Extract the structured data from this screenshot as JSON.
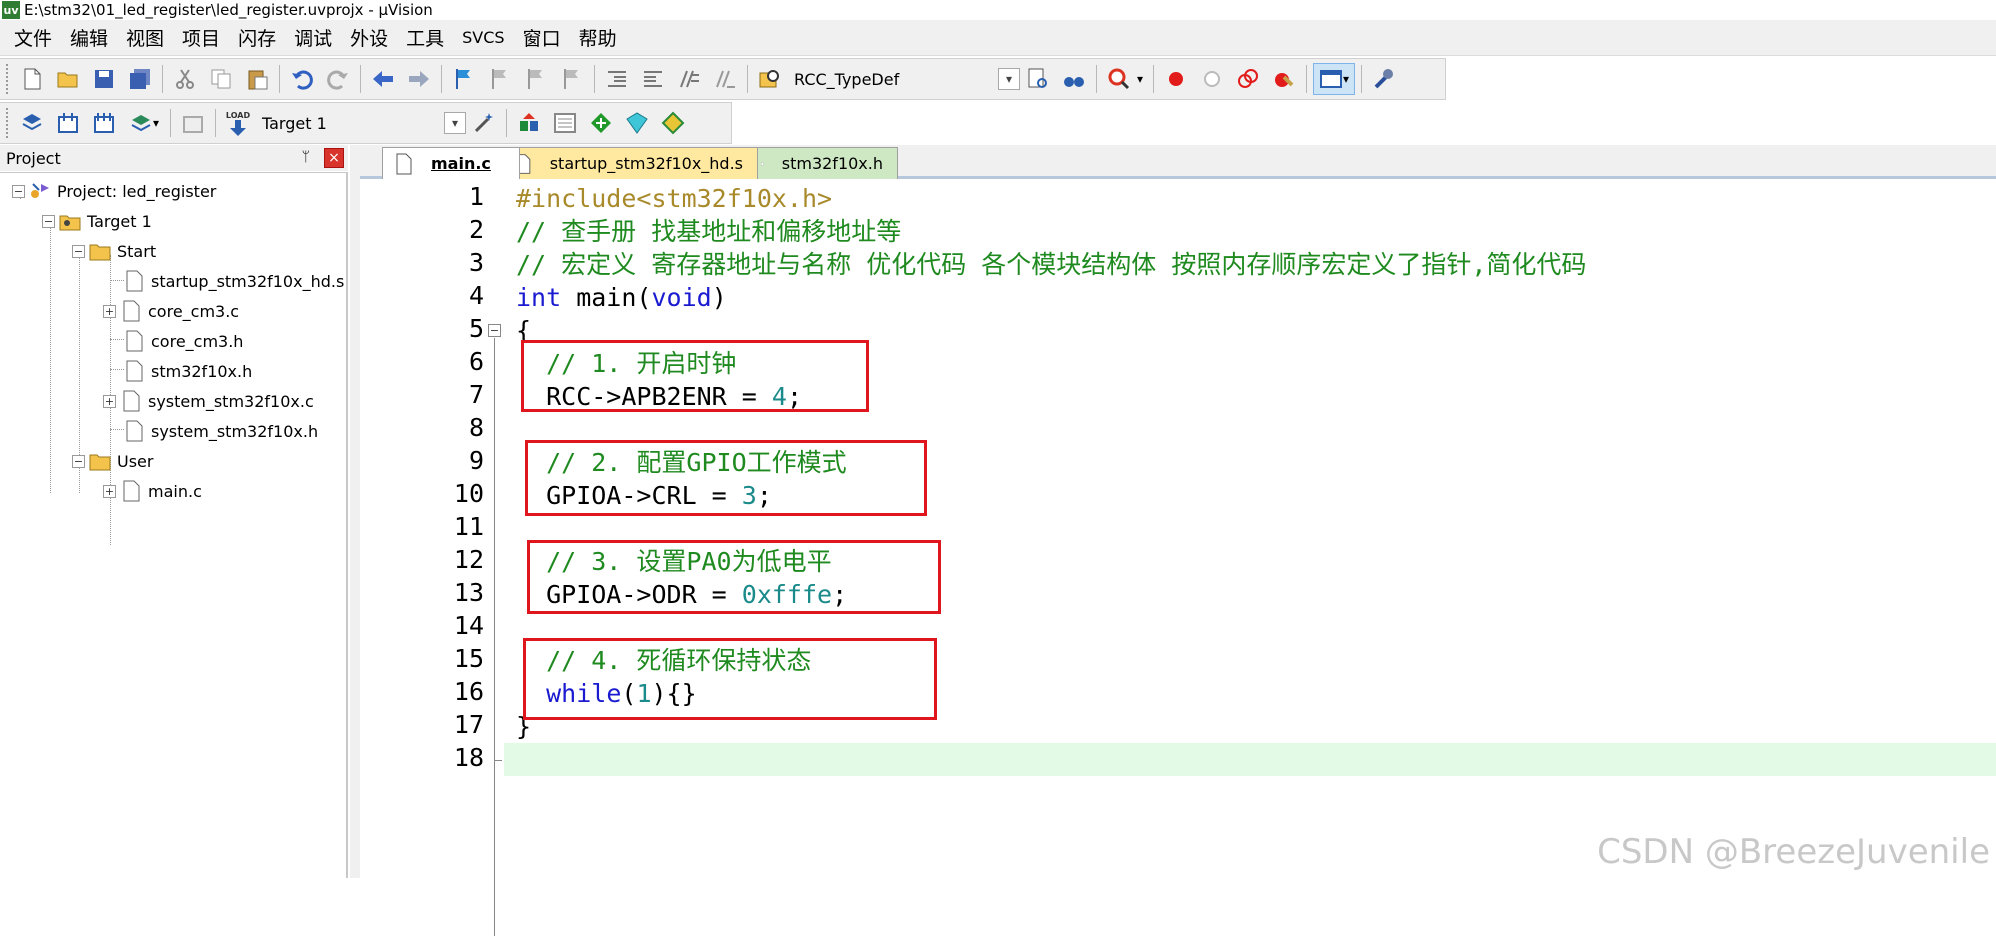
{
  "window": {
    "title": "E:\\stm32\\01_led_register\\led_register.uvprojx - µVision",
    "app_icon": "uv"
  },
  "menu": [
    "文件",
    "编辑",
    "视图",
    "项目",
    "闪存",
    "调试",
    "外设",
    "工具",
    "SVCS",
    "窗口",
    "帮助"
  ],
  "toolbar1": {
    "combo_value": "RCC_TypeDef"
  },
  "toolbar2": {
    "target_value": "Target 1",
    "load_label": "LOAD"
  },
  "project_panel": {
    "title": "Project",
    "pin_glyph": "ᛘ",
    "close_glyph": "×",
    "tree": [
      {
        "label": "Project: led_register",
        "expander": "−"
      },
      {
        "label": "Target 1",
        "expander": "−"
      },
      {
        "label": "Start",
        "expander": "−"
      },
      {
        "label": "startup_stm32f10x_hd.s",
        "expander": ""
      },
      {
        "label": "core_cm3.c",
        "expander": "+"
      },
      {
        "label": "core_cm3.h",
        "expander": ""
      },
      {
        "label": "stm32f10x.h",
        "expander": ""
      },
      {
        "label": "system_stm32f10x.c",
        "expander": "+"
      },
      {
        "label": "system_stm32f10x.h",
        "expander": ""
      },
      {
        "label": "User",
        "expander": "−"
      },
      {
        "label": "main.c",
        "expander": "+"
      }
    ]
  },
  "tabs": [
    {
      "label": "main.c",
      "active": true
    },
    {
      "label": "startup_stm32f10x_hd.s",
      "active": false
    },
    {
      "label": "stm32f10x.h",
      "active": false
    }
  ],
  "editor": {
    "fold_glyph": "−",
    "line_numbers": [
      "1",
      "2",
      "3",
      "4",
      "5",
      "6",
      "7",
      "8",
      "9",
      "10",
      "11",
      "12",
      "13",
      "14",
      "15",
      "16",
      "17",
      "18"
    ],
    "current_line": 18,
    "lines": [
      {
        "parts": [
          {
            "t": "#include<stm32f10x.h>",
            "c": "pp"
          }
        ]
      },
      {
        "parts": [
          {
            "t": "// 查手册 找基地址和偏移地址等",
            "c": "cm"
          }
        ]
      },
      {
        "parts": [
          {
            "t": "// 宏定义 寄存器地址与名称 优化代码 各个模块结构体 按照内存顺序宏定义了指针,简化代码",
            "c": "cm"
          }
        ]
      },
      {
        "parts": [
          {
            "t": "int",
            "c": "kw"
          },
          {
            "t": " main(",
            "c": "tx"
          },
          {
            "t": "void",
            "c": "kw"
          },
          {
            "t": ")",
            "c": "tx"
          }
        ]
      },
      {
        "parts": [
          {
            "t": "{",
            "c": "tx"
          }
        ]
      },
      {
        "parts": [
          {
            "t": "  // 1. 开启时钟",
            "c": "cm"
          }
        ]
      },
      {
        "parts": [
          {
            "t": "  RCC->APB2ENR = ",
            "c": "tx"
          },
          {
            "t": "4",
            "c": "num"
          },
          {
            "t": ";",
            "c": "tx"
          }
        ]
      },
      {
        "parts": []
      },
      {
        "parts": [
          {
            "t": "  // 2. 配置GPIO工作模式",
            "c": "cm"
          }
        ]
      },
      {
        "parts": [
          {
            "t": "  GPIOA->CRL = ",
            "c": "tx"
          },
          {
            "t": "3",
            "c": "num"
          },
          {
            "t": ";",
            "c": "tx"
          }
        ]
      },
      {
        "parts": []
      },
      {
        "parts": [
          {
            "t": "  // 3. 设置PA0为低电平",
            "c": "cm"
          }
        ]
      },
      {
        "parts": [
          {
            "t": "  GPIOA->ODR = ",
            "c": "tx"
          },
          {
            "t": "0xfffe",
            "c": "num"
          },
          {
            "t": ";",
            "c": "tx"
          }
        ]
      },
      {
        "parts": []
      },
      {
        "parts": [
          {
            "t": "  // 4. 死循环保持状态",
            "c": "cm"
          }
        ]
      },
      {
        "parts": [
          {
            "t": "  ",
            "c": "tx"
          },
          {
            "t": "while",
            "c": "kw"
          },
          {
            "t": "(",
            "c": "tx"
          },
          {
            "t": "1",
            "c": "num"
          },
          {
            "t": "){}",
            "c": "tx"
          }
        ]
      },
      {
        "parts": [
          {
            "t": "}",
            "c": "tx"
          }
        ]
      },
      {
        "parts": []
      }
    ]
  },
  "watermark": "CSDN @BreezeJuvenile",
  "colors": {
    "comment": "#1f8a1f",
    "keyword": "#1a1ad0",
    "number": "#1a8a8a",
    "preproc": "#a88a2b",
    "highlight_box": "#e0161e",
    "current_line": "#e3fbe6"
  }
}
